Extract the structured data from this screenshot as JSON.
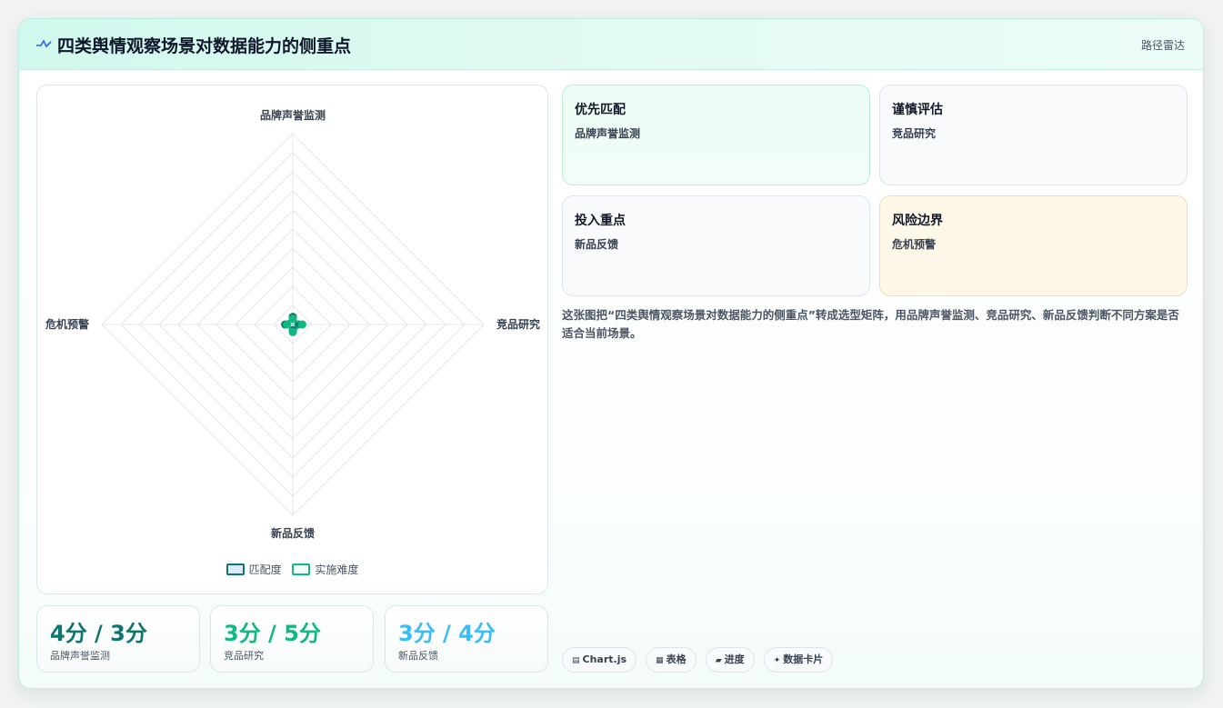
{
  "header": {
    "title": "四类舆情观察场景对数据能力的侧重点",
    "chart_type_label": "路径雷达",
    "icon": "pulse-icon"
  },
  "colors": {
    "match": "#0f766e",
    "difficulty": "#10b981",
    "sky": "#38bdf8",
    "warm_bg": "#fff7e8",
    "green_bg": "#ecfdf5"
  },
  "chart_data": {
    "type": "radar",
    "axes": [
      "品牌声誉监测",
      "竞品研究",
      "新品反馈",
      "危机预警"
    ],
    "series": [
      {
        "name": "匹配度",
        "values": [
          4,
          3,
          3,
          4
        ]
      },
      {
        "name": "实施难度",
        "values": [
          3,
          5,
          4,
          3
        ]
      }
    ],
    "rlim": [
      0,
      100
    ],
    "grid": true,
    "legend_position": "bottom"
  },
  "stats": [
    {
      "value": "4分 / 3分",
      "label": "品牌声誉监测",
      "color": "#0f766e"
    },
    {
      "value": "3分 / 5分",
      "label": "竞品研究",
      "color": "#10b981"
    },
    {
      "value": "3分 / 4分",
      "label": "新品反馈",
      "color": "#38bdf8"
    }
  ],
  "cards": [
    {
      "title": "优先匹配",
      "value": "品牌声誉监测"
    },
    {
      "title": "谨慎评估",
      "value": "竞品研究"
    },
    {
      "title": "投入重点",
      "value": "新品反馈"
    },
    {
      "title": "风险边界",
      "value": "危机预警"
    }
  ],
  "description": "这张图把“四类舆情观察场景对数据能力的侧重点”转成选型矩阵，用品牌声誉监测、竞品研究、新品反馈判断不同方案是否适合当前场景。",
  "chips": [
    {
      "icon": "▤",
      "label": "Chart.js"
    },
    {
      "icon": "▦",
      "label": "表格"
    },
    {
      "icon": "▰",
      "label": "进度"
    },
    {
      "icon": "✦",
      "label": "数据卡片"
    }
  ]
}
